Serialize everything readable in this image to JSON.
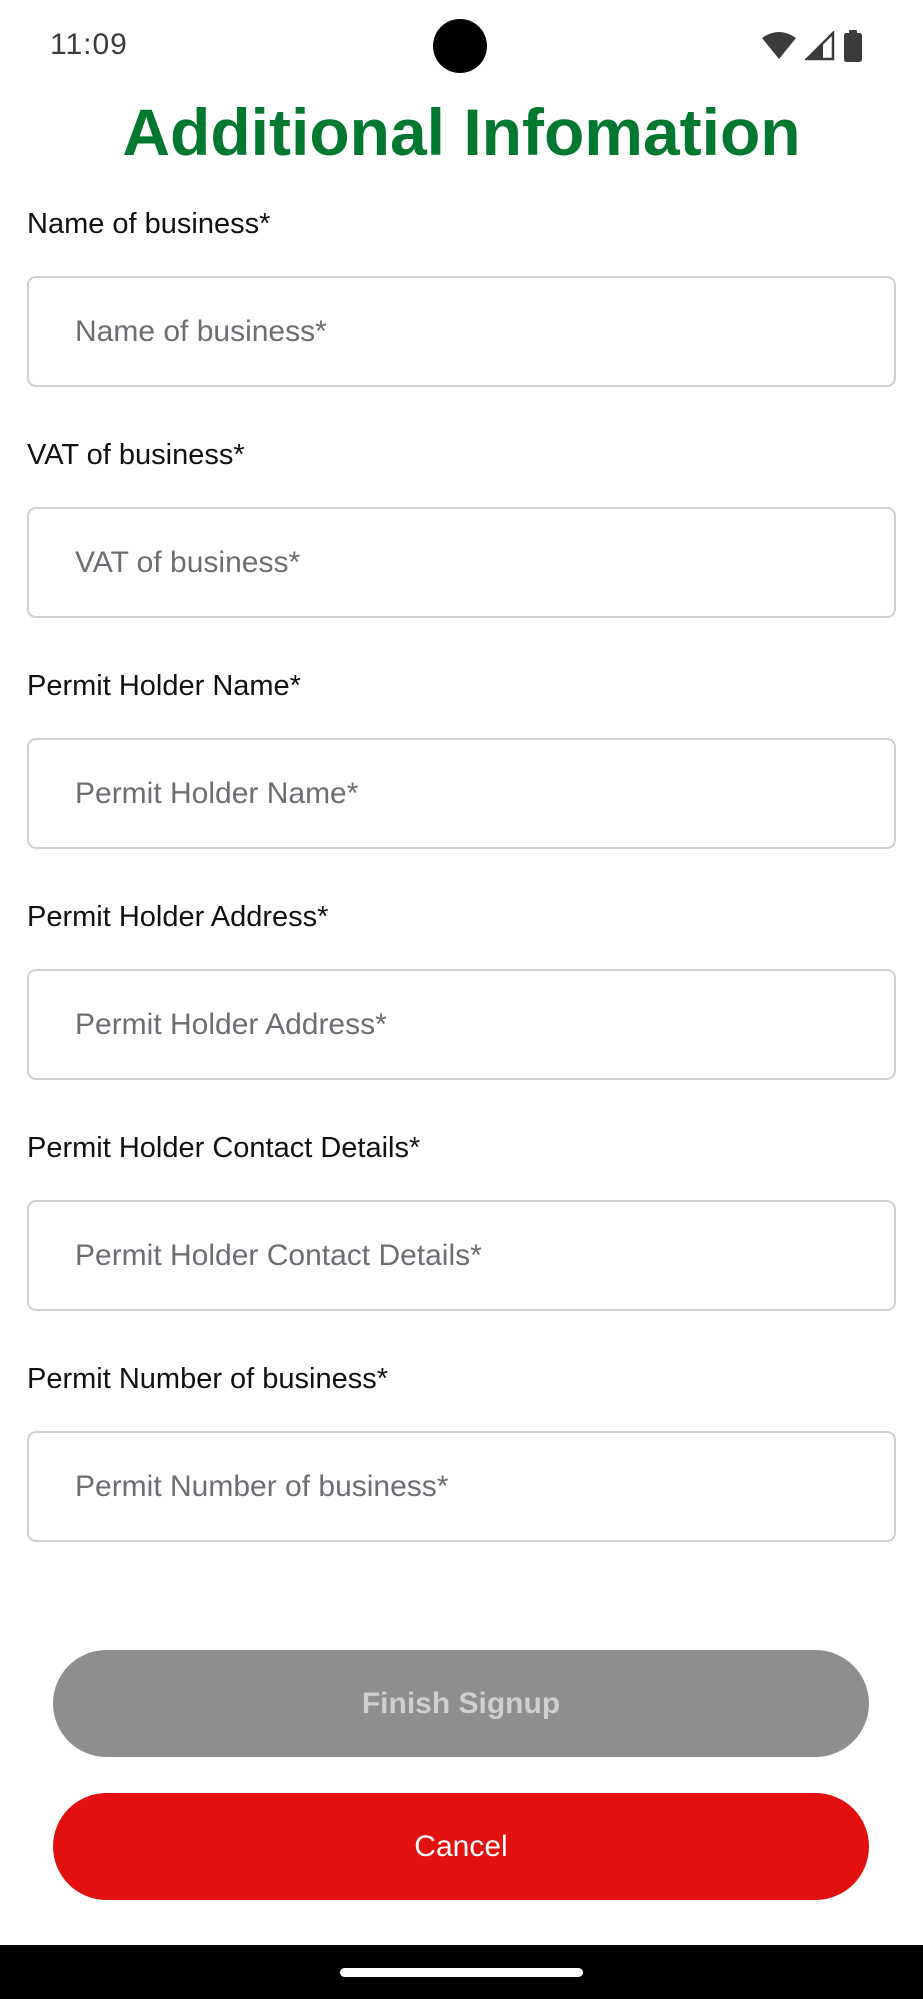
{
  "status_bar": {
    "time": "11:09",
    "icons": [
      "wifi-icon",
      "signal-icon",
      "battery-icon"
    ]
  },
  "page": {
    "title": "Additional Infomation",
    "title_color": "#00782f"
  },
  "form": {
    "fields": [
      {
        "label": "Name of business*",
        "placeholder": "Name of business*",
        "value": ""
      },
      {
        "label": "VAT of business*",
        "placeholder": "VAT of business*",
        "value": ""
      },
      {
        "label": "Permit Holder Name*",
        "placeholder": "Permit Holder Name*",
        "value": ""
      },
      {
        "label": "Permit Holder Address*",
        "placeholder": "Permit Holder Address*",
        "value": ""
      },
      {
        "label": "Permit Holder Contact Details*",
        "placeholder": "Permit Holder Contact Details*",
        "value": ""
      },
      {
        "label": "Permit Number of business*",
        "placeholder": "Permit Number of business*",
        "value": ""
      }
    ]
  },
  "actions": {
    "finish_label": "Finish Signup",
    "finish_state": "disabled",
    "finish_color": "#8e8e8e",
    "cancel_label": "Cancel",
    "cancel_color": "#e31010"
  }
}
